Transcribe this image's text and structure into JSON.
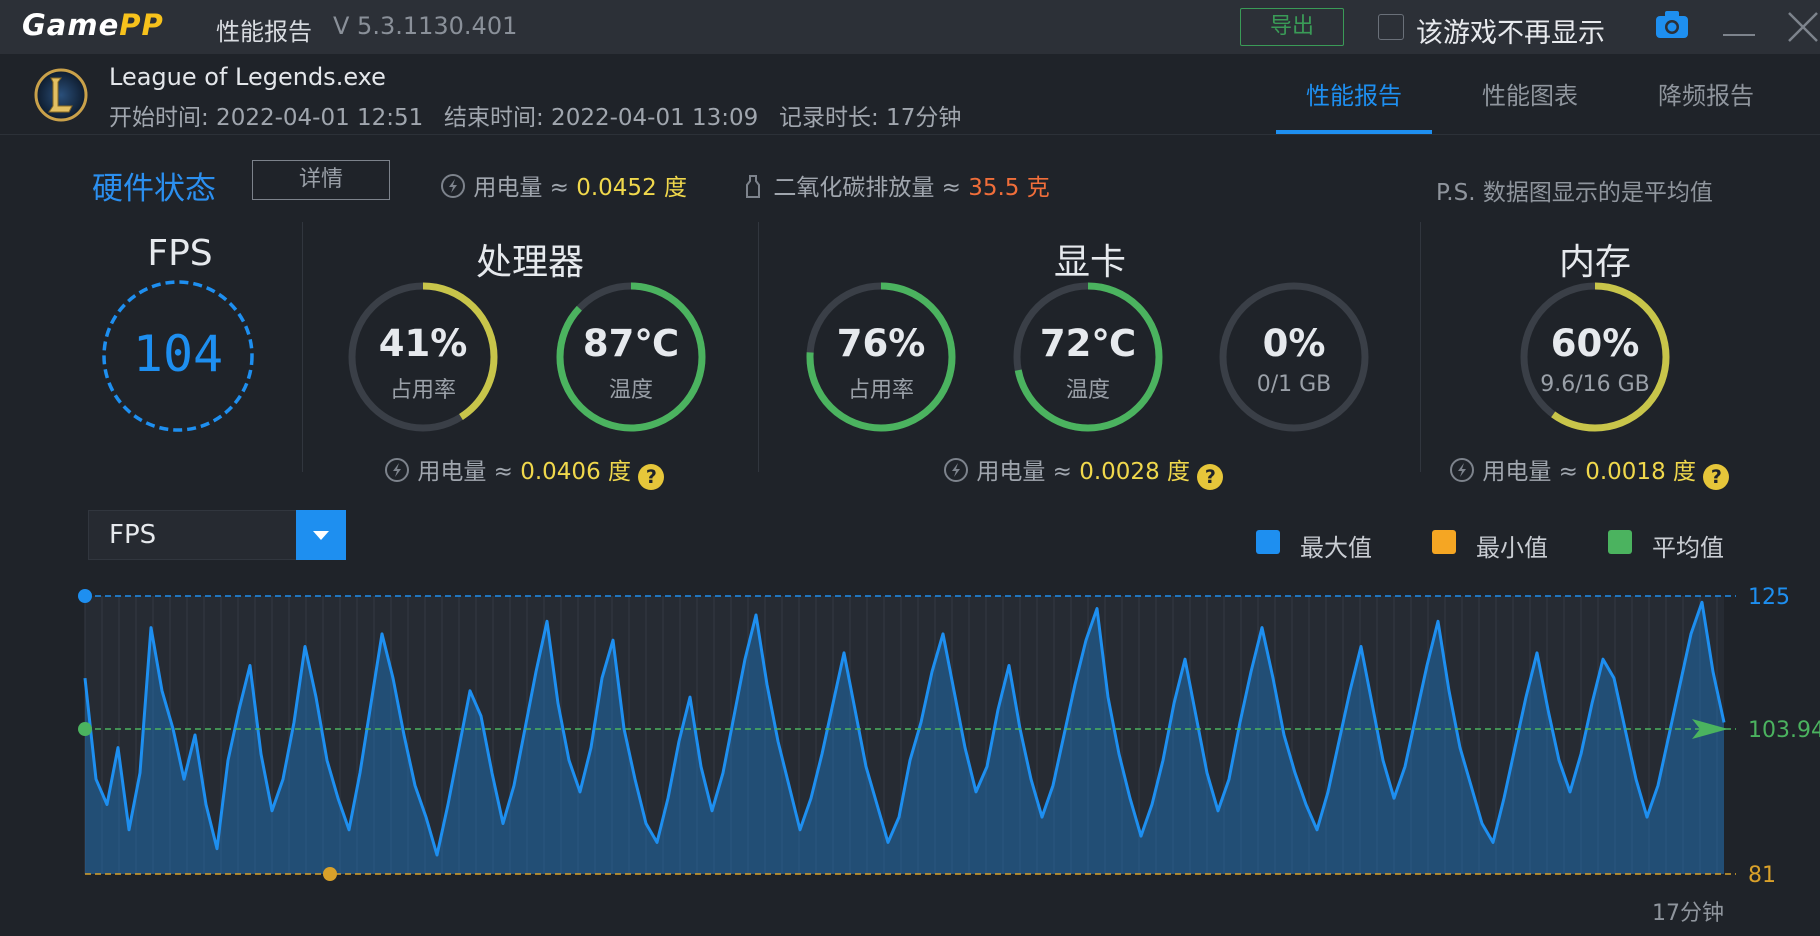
{
  "app": {
    "brand_game": "Game",
    "brand_pp": "PP",
    "title": "性能报告",
    "version": "V 5.3.1130.401"
  },
  "toolbar": {
    "export_label": "导出",
    "hide_label": "该游戏不再显示"
  },
  "game": {
    "name": "League of Legends.exe",
    "start": "开始时间: 2022-04-01 12:51",
    "end": "结束时间: 2022-04-01 13:09",
    "duration": "记录时长: 17分钟"
  },
  "tabs": [
    {
      "label": "性能报告",
      "active": true
    },
    {
      "label": "性能图表",
      "active": false
    },
    {
      "label": "降频报告",
      "active": false
    }
  ],
  "hardware": {
    "title": "硬件状态",
    "detail_label": "详情",
    "power_label": "用电量 ≈ ",
    "power_value": "0.0452 度",
    "co2_label": "二氧化碳排放量 ≈ ",
    "co2_value": "35.5 克",
    "note": "P.S. 数据图显示的是平均值"
  },
  "fps": {
    "title": "FPS",
    "value": "104"
  },
  "cpu": {
    "title": "处理器",
    "usage": {
      "value": "41%",
      "label": "占用率",
      "fraction": 0.41,
      "color": "#c8c54a"
    },
    "temp": {
      "value": "87℃",
      "label": "温度",
      "fraction": 0.87,
      "color": "#4bb35f"
    },
    "power_label": "用电量 ≈ ",
    "power_value": "0.0406 度"
  },
  "gpu": {
    "title": "显卡",
    "usage": {
      "value": "76%",
      "label": "占用率",
      "fraction": 0.76,
      "color": "#4bb35f"
    },
    "temp": {
      "value": "72℃",
      "label": "温度",
      "fraction": 0.72,
      "color": "#4bb35f"
    },
    "vram": {
      "value": "0%",
      "label": "0/1 GB",
      "fraction": 0.0,
      "color": "#4bb35f"
    },
    "power_label": "用电量 ≈ ",
    "power_value": "0.0028 度"
  },
  "memory": {
    "title": "内存",
    "usage": {
      "value": "60%",
      "label": "9.6/16 GB",
      "fraction": 0.6,
      "color": "#c8c54a"
    },
    "power_label": "用电量 ≈ ",
    "power_value": "0.0018 度"
  },
  "chart": {
    "selected_metric": "FPS",
    "legend": [
      {
        "label": "最大值",
        "color": "#1e8ff0"
      },
      {
        "label": "最小值",
        "color": "#f5a623"
      },
      {
        "label": "平均值",
        "color": "#4bb35f"
      }
    ],
    "end_label": "17分钟"
  },
  "chart_data": {
    "type": "area",
    "series": [
      {
        "values": [
          112,
          96,
          92,
          101,
          88,
          97,
          120,
          110,
          104,
          96,
          103,
          92,
          85,
          99,
          107,
          114,
          100,
          91,
          96,
          105,
          117,
          109,
          99,
          93,
          88,
          97,
          108,
          119,
          112,
          103,
          95,
          90,
          84,
          92,
          101,
          110,
          106,
          97,
          89,
          95,
          104,
          113,
          121,
          108,
          99,
          94,
          101,
          112,
          118,
          104,
          96,
          89,
          86,
          93,
          102,
          109,
          98,
          91,
          97,
          106,
          115,
          122,
          111,
          102,
          95,
          88,
          93,
          100,
          108,
          116,
          107,
          98,
          92,
          86,
          90,
          99,
          105,
          113,
          119,
          110,
          101,
          94,
          98,
          107,
          114,
          104,
          96,
          90,
          95,
          103,
          111,
          118,
          123,
          109,
          100,
          93,
          87,
          92,
          99,
          108,
          115,
          106,
          97,
          91,
          96,
          105,
          113,
          120,
          112,
          103,
          97,
          92,
          88,
          94,
          102,
          110,
          117,
          108,
          99,
          93,
          98,
          106,
          114,
          121,
          110,
          101,
          95,
          89,
          86,
          93,
          101,
          109,
          116,
          107,
          99,
          94,
          100,
          108,
          115,
          112,
          104,
          96,
          90,
          95,
          103,
          111,
          119,
          124,
          113,
          105
        ]
      }
    ],
    "xlabel": "17分钟",
    "ylim": [
      81,
      125
    ],
    "max": 125,
    "min": 81,
    "avg": 103.94
  }
}
